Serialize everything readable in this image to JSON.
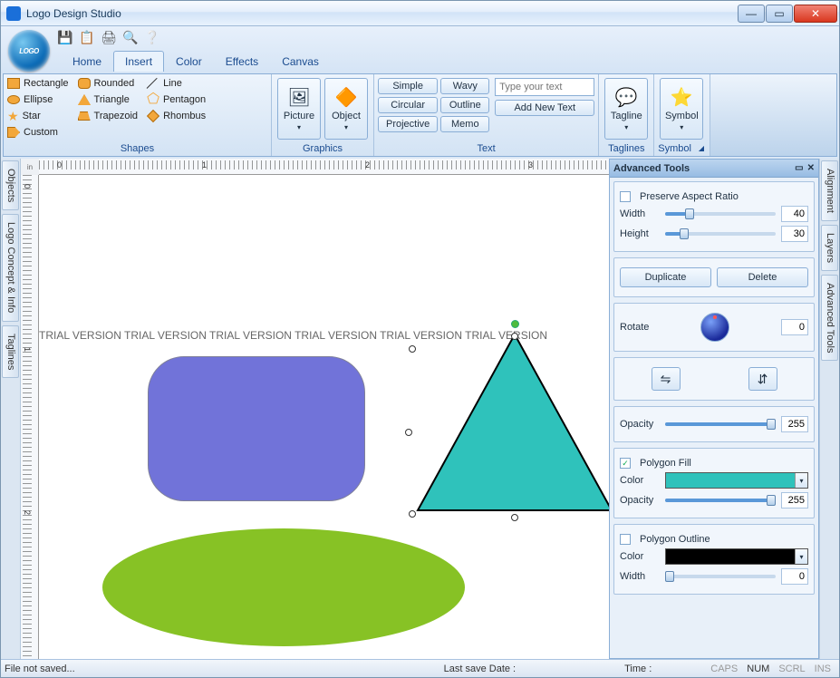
{
  "window": {
    "title": "Logo Design Studio"
  },
  "tabs": [
    "Home",
    "Insert",
    "Color",
    "Effects",
    "Canvas"
  ],
  "active_tab_index": 1,
  "ribbon": {
    "shapes_title": "Shapes",
    "shapes": {
      "col1": [
        "Rectangle",
        "Ellipse",
        "Star",
        "Custom"
      ],
      "col2": [
        "Rounded",
        "Triangle",
        "Trapezoid"
      ],
      "col3": [
        "Line",
        "Pentagon",
        "Rhombus"
      ]
    },
    "graphics_title": "Graphics",
    "picture_label": "Picture",
    "object_label": "Object",
    "text_title": "Text",
    "text_buttons": [
      "Simple",
      "Wavy",
      "Circular",
      "Outline",
      "Projective",
      "Memo"
    ],
    "text_placeholder": "Type your text",
    "add_text_label": "Add New Text",
    "taglines_title": "Taglines",
    "tagline_label": "Tagline",
    "symbol_title": "Symbol",
    "symbol_label": "Symbol"
  },
  "left_tabs": [
    "Objects",
    "Logo Concept & Info",
    "Taglines"
  ],
  "right_tabs": [
    "Alignment",
    "Layers",
    "Advanced Tools"
  ],
  "watermark": "TRIAL VERSION   TRIAL VERSION   TRIAL VERSION   TRIAL VERSION   TRIAL VERSION   TRIAL VERSION",
  "canvas": {
    "ruler_unit": "in",
    "ruler_h": [
      "0",
      "1",
      "2",
      "3"
    ],
    "ruler_v": [
      "0",
      "1",
      "2"
    ]
  },
  "adv": {
    "title": "Advanced Tools",
    "preserve_label": "Preserve Aspect Ratio",
    "preserve_checked": false,
    "width_label": "Width",
    "width_value": "40",
    "height_label": "Height",
    "height_value": "30",
    "duplicate_label": "Duplicate",
    "delete_label": "Delete",
    "rotate_label": "Rotate",
    "rotate_value": "0",
    "opacity_label": "Opacity",
    "opacity_value": "255",
    "fill_label": "Polygon Fill",
    "fill_checked": true,
    "fill_color": "#2fc2bb",
    "fill_opacity_label": "Opacity",
    "fill_opacity_value": "255",
    "outline_label": "Polygon Outline",
    "outline_checked": false,
    "outline_color": "#000000",
    "outline_width_label": "Width",
    "outline_width_value": "0",
    "color_label": "Color"
  },
  "status": {
    "file": "File not saved...",
    "save_date_label": "Last save Date :",
    "time_label": "Time :",
    "caps": "CAPS",
    "num": "NUM",
    "scrl": "SCRL",
    "ins": "INS"
  }
}
